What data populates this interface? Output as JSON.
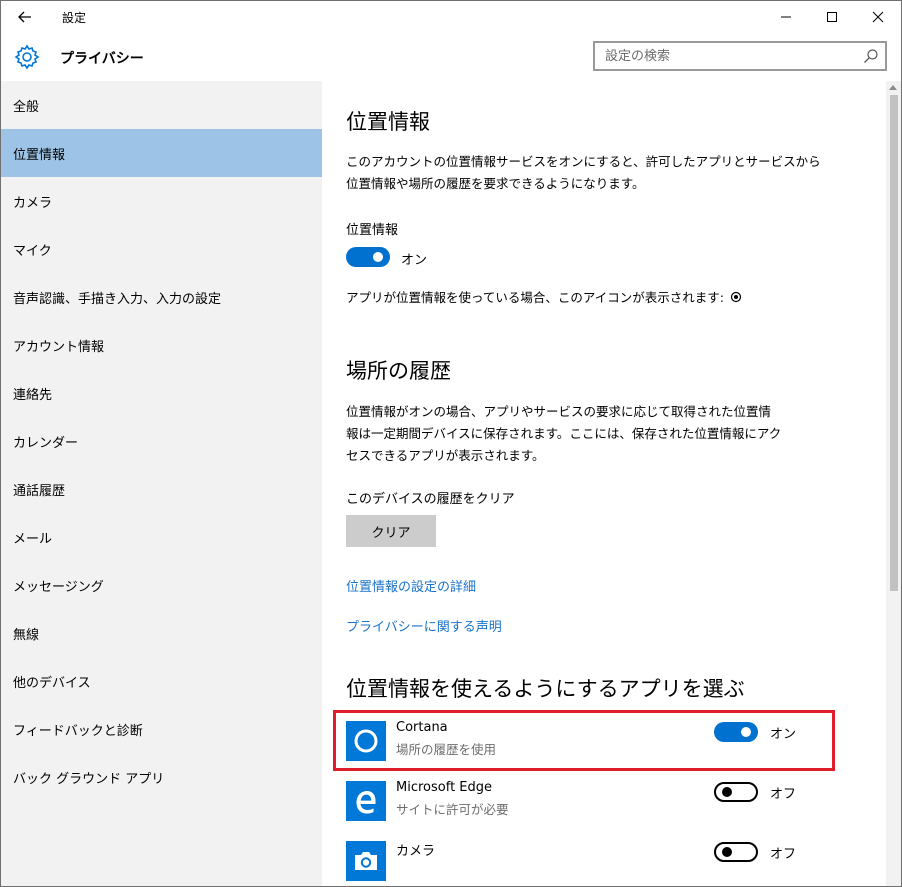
{
  "window": {
    "title": "設定"
  },
  "header": {
    "title": "プライバシー"
  },
  "search": {
    "placeholder": "設定の検索"
  },
  "sidebar": {
    "items": [
      {
        "label": "全般"
      },
      {
        "label": "位置情報"
      },
      {
        "label": "カメラ"
      },
      {
        "label": "マイク"
      },
      {
        "label": "音声認識、手描き入力、入力の設定"
      },
      {
        "label": "アカウント情報"
      },
      {
        "label": "連絡先"
      },
      {
        "label": "カレンダー"
      },
      {
        "label": "通話履歴"
      },
      {
        "label": "メール"
      },
      {
        "label": "メッセージング"
      },
      {
        "label": "無線"
      },
      {
        "label": "他のデバイス"
      },
      {
        "label": "フィードバックと診断"
      },
      {
        "label": "バック グラウンド アプリ"
      }
    ],
    "selected": "位置情報"
  },
  "content": {
    "location": {
      "heading": "位置情報",
      "description": "このアカウントの位置情報サービスをオンにすると、許可したアプリとサービスから\n位置情報や場所の履歴を要求できるようになります。",
      "toggle_label": "位置情報",
      "toggle_state": "オン",
      "icon_note": "アプリが位置情報を使っている場合、このアイコンが表示されます:"
    },
    "history": {
      "heading": "場所の履歴",
      "description": "位置情報がオンの場合、アプリやサービスの要求に応じて取得された位置情\n報は一定期間デバイスに保存されます。ここには、保存された位置情報にアク\nセスできるアプリが表示されます。",
      "clear_label": "このデバイスの履歴をクリア",
      "clear_button": "クリア"
    },
    "links": {
      "detail": "位置情報の設定の詳細",
      "privacy": "プライバシーに関する声明"
    },
    "apps": {
      "heading": "位置情報を使えるようにするアプリを選ぶ",
      "items": [
        {
          "name": "Cortana",
          "sub": "場所の履歴を使用",
          "state": "オン"
        },
        {
          "name": "Microsoft Edge",
          "sub": "サイトに許可が必要",
          "state": "オフ"
        },
        {
          "name": "カメラ",
          "sub": "",
          "state": "オフ"
        }
      ]
    }
  },
  "colors": {
    "accent": "#0078d7",
    "toggle_on": "#0071cf",
    "selected_nav": "#9dc4e7",
    "sidebar_bg": "#f2f2f2",
    "link": "#1a73c9",
    "highlight_border": "#e01e2b"
  },
  "icons": [
    "back-arrow-icon",
    "minimize-icon",
    "maximize-icon",
    "close-icon",
    "gear-icon",
    "search-icon",
    "location-indicator-icon",
    "cortana-icon",
    "edge-icon",
    "camera-icon"
  ]
}
